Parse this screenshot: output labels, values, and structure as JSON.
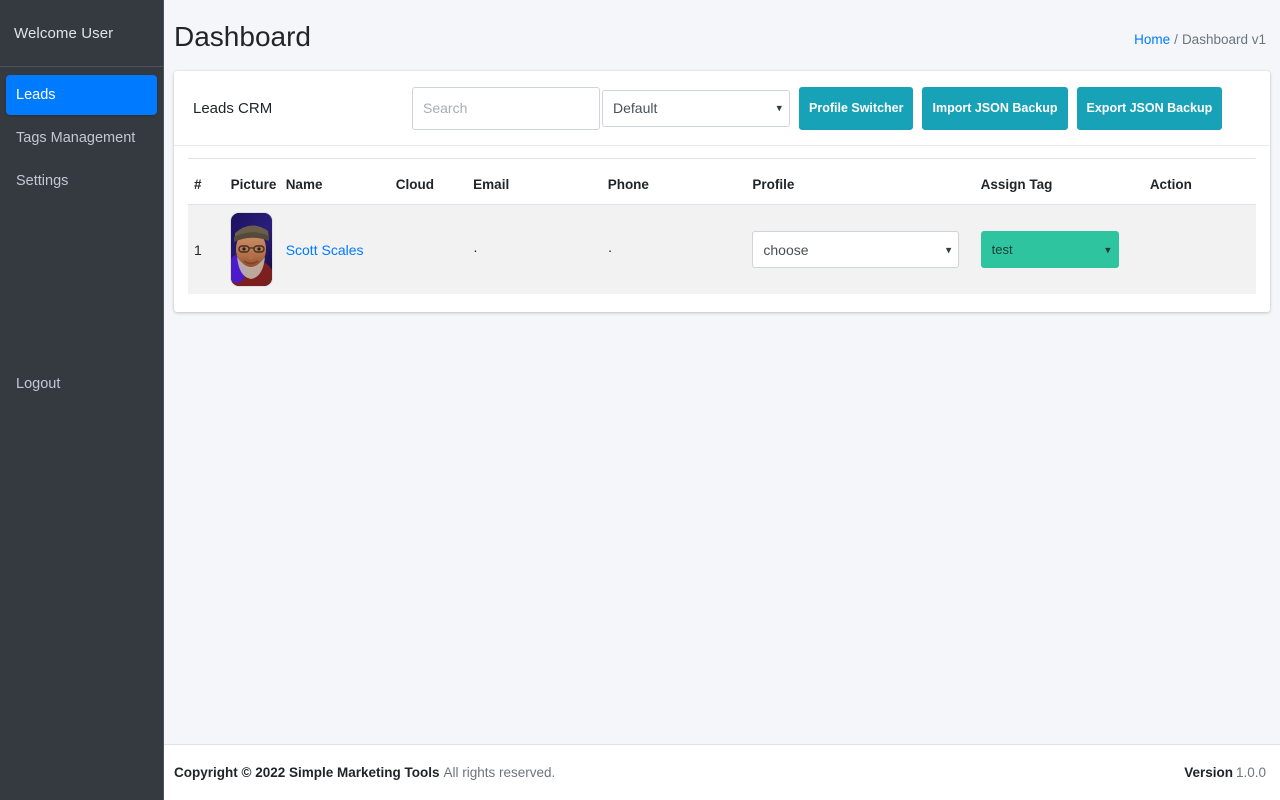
{
  "sidebar": {
    "brand_label": "Welcome User",
    "items": [
      {
        "label": "Leads",
        "active": true
      },
      {
        "label": "Tags Management",
        "active": false
      },
      {
        "label": "Settings",
        "active": false
      }
    ],
    "logout_label": "Logout"
  },
  "header": {
    "title": "Dashboard",
    "breadcrumb": {
      "home_label": "Home",
      "separator": "/",
      "current_label": "Dashboard v1"
    }
  },
  "card": {
    "title": "Leads CRM",
    "search": {
      "placeholder": "Search",
      "value": ""
    },
    "profile_filter": {
      "selected": "Default",
      "options": [
        "Default"
      ]
    },
    "buttons": [
      {
        "label": "Profile Switcher",
        "name": "profile-switcher-button"
      },
      {
        "label": "Import JSON Backup",
        "name": "import-json-backup-button"
      },
      {
        "label": "Export JSON Backup",
        "name": "export-json-backup-button"
      }
    ]
  },
  "table": {
    "columns": [
      "#",
      "Picture",
      "Name",
      "Cloud",
      "Email",
      "Phone",
      "Profile",
      "Assign Tag",
      "Action"
    ],
    "rows": [
      {
        "index": "1",
        "picture_alt": "lead-avatar",
        "name": "Scott Scales",
        "cloud": "",
        "email": "·",
        "phone": "·",
        "profile_select": {
          "selected": "choose",
          "options": [
            "choose"
          ]
        },
        "tag_select": {
          "selected": "test",
          "options": [
            "test"
          ]
        },
        "action": ""
      }
    ]
  },
  "footer": {
    "copyright_strong": "Copyright © 2022 Simple Marketing Tools",
    "copyright_rest": "All rights reserved.",
    "version_label": "Version",
    "version_number": "1.0.0"
  },
  "colors": {
    "sidebar_bg": "#343a40",
    "accent_blue": "#007bff",
    "button_teal": "#17a2b8",
    "tag_green": "#2ec4a0",
    "page_bg": "#f4f6f9"
  }
}
